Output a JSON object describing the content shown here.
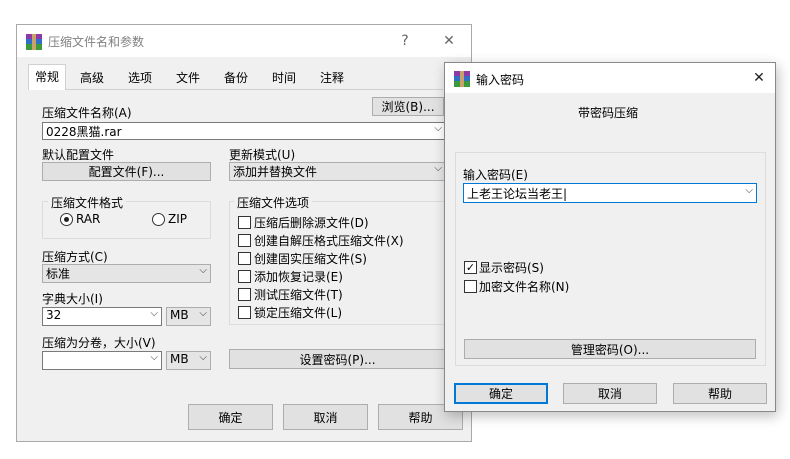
{
  "main_window": {
    "title": "压缩文件名和参数",
    "help_glyph": "?",
    "close_glyph": "✕",
    "tabs": [
      {
        "label": "常规",
        "active": true
      },
      {
        "label": "高级"
      },
      {
        "label": "选项"
      },
      {
        "label": "文件"
      },
      {
        "label": "备份"
      },
      {
        "label": "时间"
      },
      {
        "label": "注释"
      }
    ],
    "archive_name_label": "压缩文件名称(A)",
    "browse_label": "浏览(B)...",
    "archive_name_value": "0228黑猫.rar",
    "default_profile_label": "默认配置文件",
    "profile_button_label": "配置文件(F)...",
    "update_mode_label": "更新模式(U)",
    "update_mode_value": "添加并替换文件",
    "format_group_label": "压缩文件格式",
    "format_rar_label": "RAR",
    "format_zip_label": "ZIP",
    "options_group_label": "压缩文件选项",
    "options": [
      {
        "label": "压缩后删除源文件(D)",
        "checked": false
      },
      {
        "label": "创建自解压格式压缩文件(X)",
        "checked": false
      },
      {
        "label": "创建固实压缩文件(S)",
        "checked": false
      },
      {
        "label": "添加恢复记录(E)",
        "checked": false
      },
      {
        "label": "测试压缩文件(T)",
        "checked": false
      },
      {
        "label": "锁定压缩文件(L)",
        "checked": false
      }
    ],
    "method_label": "压缩方式(C)",
    "method_value": "标准",
    "dict_size_label": "字典大小(I)",
    "dict_size_value": "32",
    "dict_unit": "MB",
    "split_label": "压缩为分卷，大小(V)",
    "split_value": "",
    "split_unit": "MB",
    "set_password_label": "设置密码(P)...",
    "ok_label": "确定",
    "cancel_label": "取消",
    "help_label": "帮助"
  },
  "password_dialog": {
    "title": "输入密码",
    "close_glyph": "✕",
    "heading": "带密码压缩",
    "password_label": "输入密码(E)",
    "password_value": "上老王论坛当老王|",
    "show_password_label": "显示密码(S)",
    "show_password_checked": true,
    "encrypt_names_label": "加密文件名称(N)",
    "encrypt_names_checked": false,
    "manage_label": "管理密码(O)...",
    "ok_label": "确定",
    "cancel_label": "取消",
    "help_label": "帮助"
  },
  "icons": {
    "dropdown": "⌵",
    "check": "✓"
  },
  "colors": {
    "accent": "#0078d7",
    "window_bg": "#f0f0f0"
  }
}
